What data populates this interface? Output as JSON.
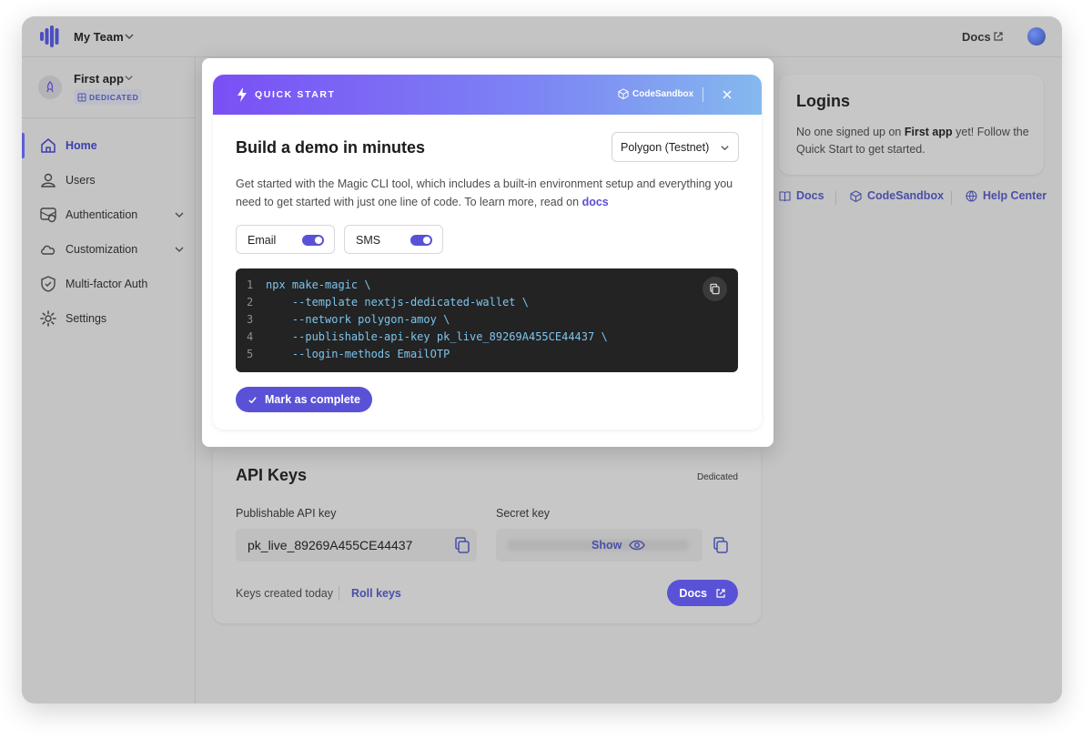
{
  "topbar": {
    "team_name": "My Team",
    "docs_label": "Docs"
  },
  "sidebar": {
    "app_name": "First app",
    "badge": "DEDICATED",
    "items": [
      {
        "label": "Home",
        "icon": "home-icon",
        "active": true
      },
      {
        "label": "Users",
        "icon": "user-icon",
        "active": false
      },
      {
        "label": "Authentication",
        "icon": "authentication-icon",
        "active": false,
        "expandable": true
      },
      {
        "label": "Customization",
        "icon": "cloud-icon",
        "active": false,
        "expandable": true
      },
      {
        "label": "Multi-factor Auth",
        "icon": "shield-icon",
        "active": false
      },
      {
        "label": "Settings",
        "icon": "gear-icon",
        "active": false
      }
    ]
  },
  "logins": {
    "title": "Logins",
    "text_before": "No one signed up on ",
    "app_bold": "First app",
    "text_after": " yet! Follow the Quick Start to get started."
  },
  "links": {
    "docs": "Docs",
    "codesandbox": "CodeSandbox",
    "help": "Help Center"
  },
  "api_keys": {
    "title": "API Keys",
    "tier": "Dedicated",
    "publishable_label": "Publishable API key",
    "publishable_value": "pk_live_89269A455CE44437",
    "secret_label": "Secret key",
    "show_label": "Show",
    "created": "Keys created today",
    "roll": "Roll keys",
    "docs": "Docs"
  },
  "modal": {
    "header_label": "QUICK START",
    "codesandbox": "CodeSandbox",
    "title": "Build a demo in minutes",
    "network_selected": "Polygon (Testnet)",
    "desc": "Get started with the Magic CLI tool, which includes a built-in environment setup and everything you need to get started with just one line of code. To learn more, read on ",
    "docs_link": "docs",
    "toggles": [
      {
        "label": "Email",
        "on": true
      },
      {
        "label": "SMS",
        "on": true
      }
    ],
    "code_lines": [
      {
        "n": "1",
        "text": "npx make-magic \\"
      },
      {
        "n": "2",
        "text": "    --template nextjs-dedicated-wallet \\"
      },
      {
        "n": "3",
        "text": "    --network polygon-amoy \\"
      },
      {
        "n": "4",
        "text": "    --publishable-api-key pk_live_89269A455CE44437 \\"
      },
      {
        "n": "5",
        "text": "    --login-methods EmailOTP"
      }
    ],
    "mark_complete": "Mark as complete"
  },
  "colors": {
    "accent": "#5a52d6",
    "link": "#4a4ea8",
    "code_bg": "#232323",
    "code_text": "#7cc5ee"
  }
}
